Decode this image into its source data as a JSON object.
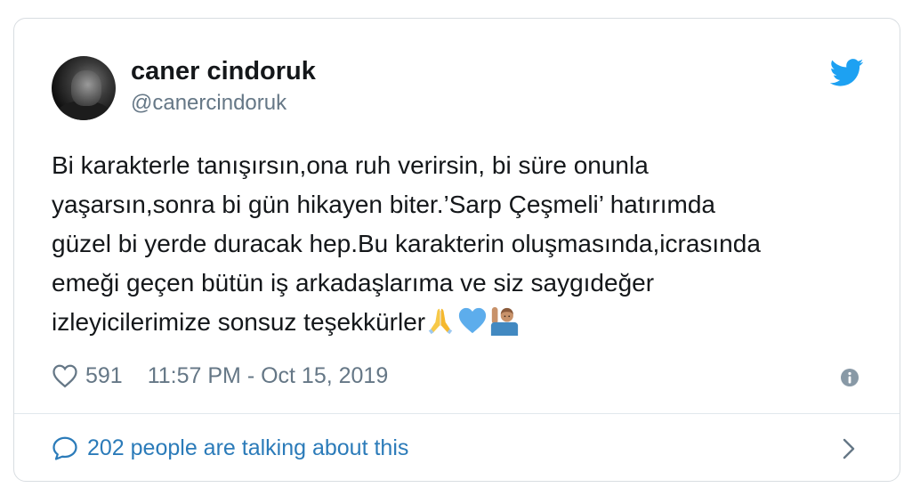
{
  "author": {
    "name": "caner cindoruk",
    "handle": "@canercindoruk"
  },
  "tweet": {
    "text": "Bi karakterle tanışırsın,ona ruh verirsin, bi süre onunla\nyaşarsın,sonra bi gün hikayen biter.’Sarp Çeşmeli’ hatırımda\ngüzel bi yerde duracak hep.Bu karakterin oluşmasında,icrasında\nemeği geçen bütün iş arkadaşlarıma ve siz saygıdeğer\nizleyicilerimize sonsuz teşekkürler",
    "emojis": [
      "folded-hands",
      "blue-heart",
      "person-raising-hand"
    ]
  },
  "meta": {
    "likes": "591",
    "timestamp": "11:57 PM - Oct 15, 2019"
  },
  "footer": {
    "talking": "202 people are talking about this"
  },
  "colors": {
    "twitter_blue": "#1da1f2",
    "link_blue": "#2b7bb9",
    "muted": "#657786",
    "text": "#14171a"
  }
}
